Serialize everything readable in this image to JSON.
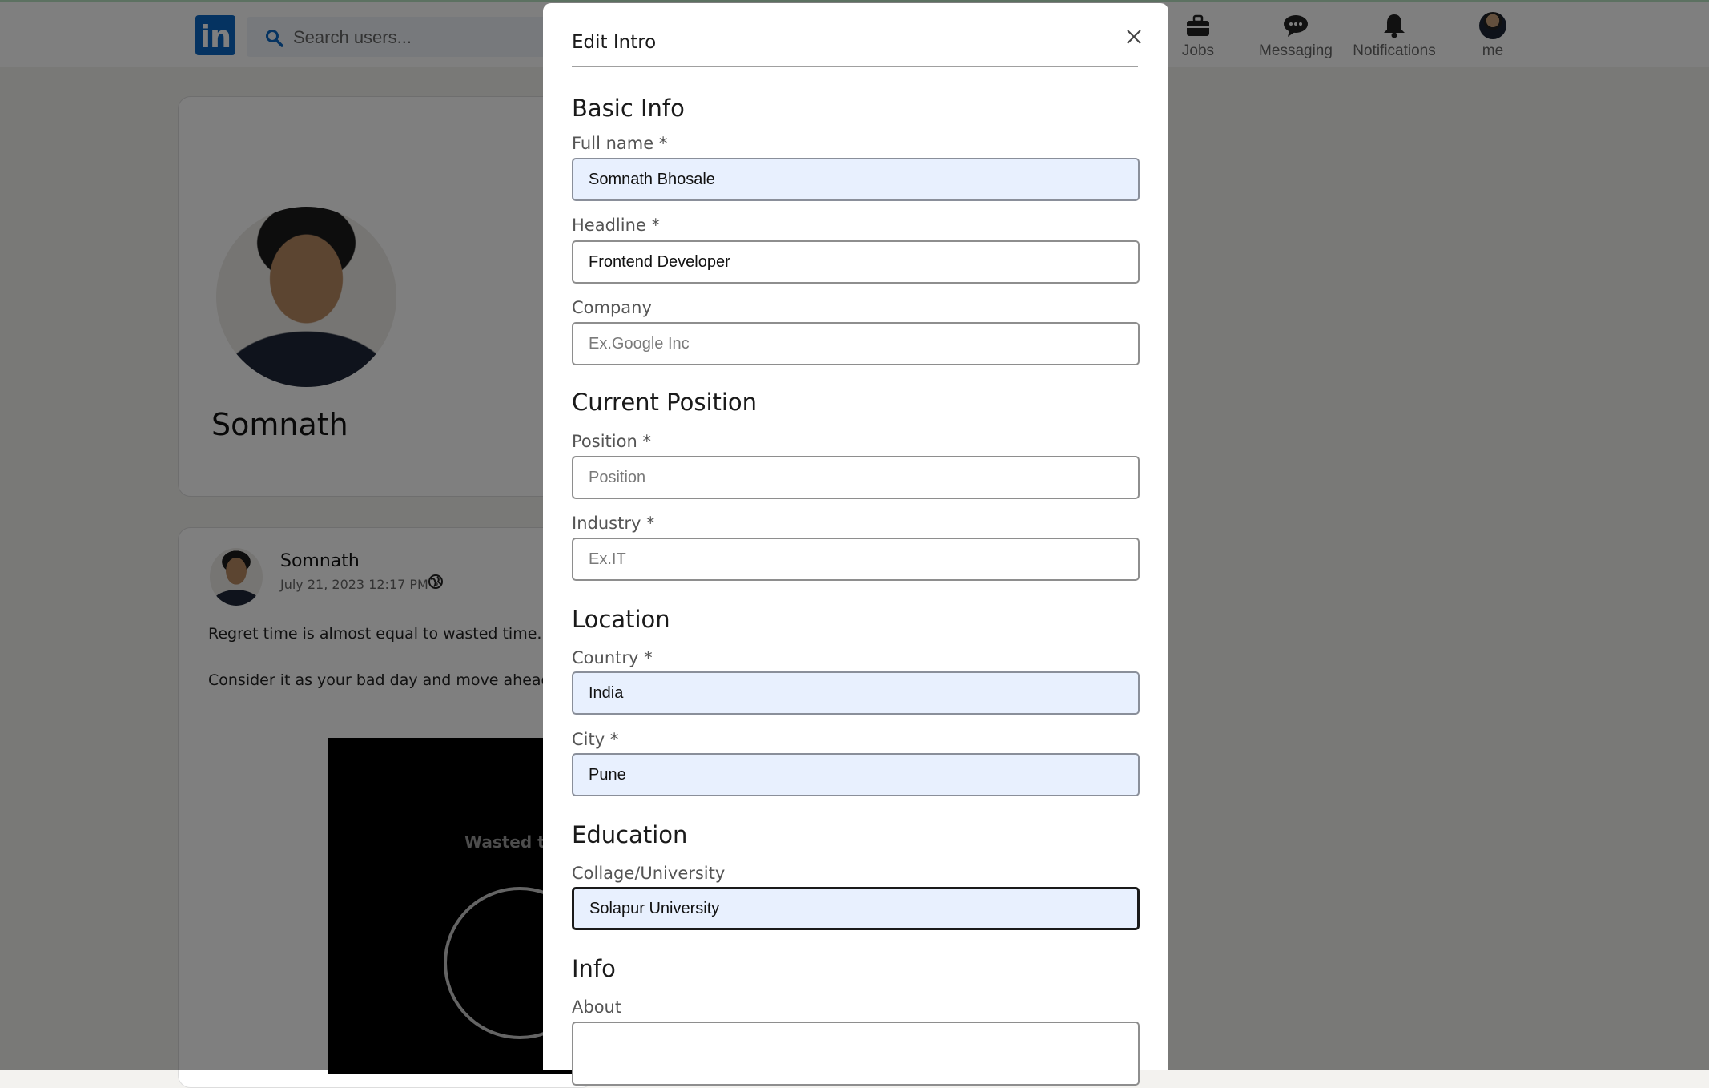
{
  "topbar": {
    "logo_text": "in",
    "search_placeholder": "Search users...",
    "nav": [
      {
        "label": "Jobs",
        "icon": "briefcase-icon"
      },
      {
        "label": "Messaging",
        "icon": "chat-bubble-icon"
      },
      {
        "label": "Notifications",
        "icon": "bell-icon"
      },
      {
        "label": "me",
        "icon": "avatar"
      }
    ]
  },
  "profile": {
    "name": "Somnath"
  },
  "post": {
    "author": "Somnath",
    "timestamp": "July 21, 2023 12:17 PM •",
    "line1": "Regret time is almost equal to wasted time.",
    "line2": "Consider it as your bad day and move ahead 😊",
    "image_text": "Wasted ti"
  },
  "modal": {
    "title": "Edit Intro",
    "sections": {
      "basic": "Basic Info",
      "position": "Current Position",
      "location": "Location",
      "education": "Education",
      "info": "Info"
    },
    "fields": {
      "full_name": {
        "label": "Full name *",
        "value": "Somnath Bhosale",
        "placeholder": ""
      },
      "headline": {
        "label": "Headline *",
        "value": "Frontend Developer",
        "placeholder": ""
      },
      "company": {
        "label": "Company",
        "value": "",
        "placeholder": "Ex.Google Inc"
      },
      "position": {
        "label": "Position *",
        "value": "",
        "placeholder": "Position"
      },
      "industry": {
        "label": "Industry *",
        "value": "",
        "placeholder": "Ex.IT"
      },
      "country": {
        "label": "Country *",
        "value": "India",
        "placeholder": ""
      },
      "city": {
        "label": "City *",
        "value": "Pune",
        "placeholder": ""
      },
      "college": {
        "label": "Collage/University",
        "value": "Solapur University",
        "placeholder": ""
      },
      "about": {
        "label": "About",
        "value": "",
        "placeholder": ""
      }
    }
  },
  "colors": {
    "brand": "#0a66c2",
    "overlay": "rgba(0,0,0,0.5)",
    "autofill": "#e8f0fe"
  }
}
